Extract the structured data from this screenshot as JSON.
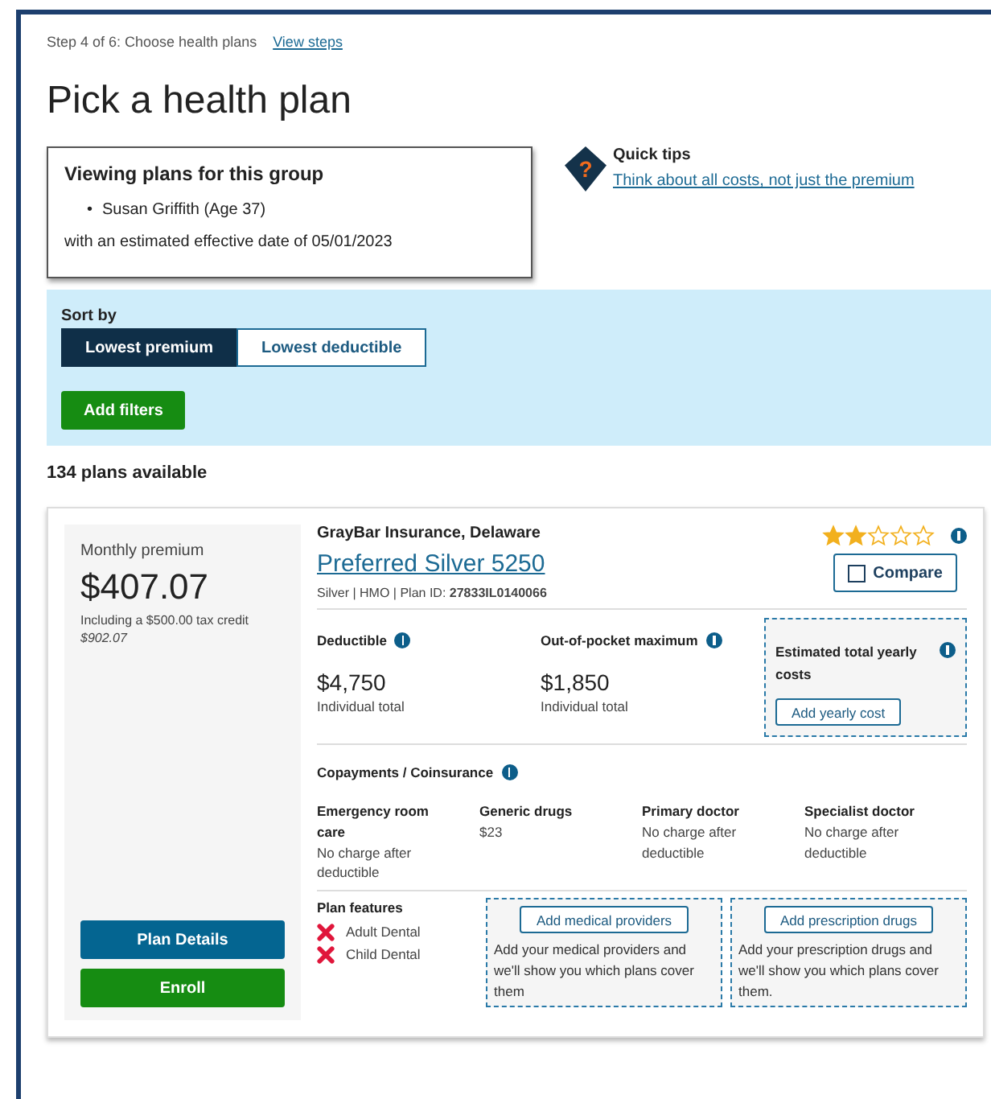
{
  "breadcrumb": {
    "step": "Step 4 of 6: Choose health plans",
    "link": "View steps"
  },
  "title": "Pick a health plan",
  "group": {
    "heading": "Viewing plans for this group",
    "bullet": "•",
    "members": [
      "Susan Griffith (Age 37)"
    ],
    "note": "with an estimated effective date of 05/01/2023"
  },
  "tips": {
    "icon": "?",
    "heading": "Quick tips",
    "link": "Think about all costs, not just the premium"
  },
  "sort": {
    "label": "Sort by",
    "options": [
      {
        "label": "Lowest premium",
        "selected": true
      },
      {
        "label": "Lowest deductible",
        "selected": false
      }
    ],
    "filter_button": "Add filters"
  },
  "count": "134 plans available",
  "plan": {
    "premium_label": "Monthly premium",
    "premium": "$407.07",
    "credit": "Including a $500.00 tax credit",
    "full_price": "$902.07",
    "insurer": "GrayBar Insurance, Delaware",
    "name": "Preferred Silver 5250",
    "meta": "Silver | HMO | Plan ID: ",
    "plan_id": "27833IL0140066",
    "stars": 2,
    "compare": {
      "label": "Compare",
      "checked": false
    },
    "costs": [
      {
        "label": "Deductible",
        "value": "$4,750",
        "note": "Individual total"
      },
      {
        "label": "Out-of-pocket maximum",
        "value": "$1,850",
        "note": "Individual total"
      }
    ],
    "yearly": {
      "label": "Estimated total yearly costs",
      "button": "Add yearly cost"
    },
    "copay_heading": "Copayments / Coinsurance",
    "copays": [
      {
        "label": "Emergency room care",
        "value": "No charge after deductible"
      },
      {
        "label": "Generic drugs",
        "value": "$23"
      },
      {
        "label": "Primary doctor",
        "value": "No charge after deductible"
      },
      {
        "label": "Specialist doctor",
        "value": "No charge after deductible"
      }
    ],
    "features_heading": "Plan features",
    "features": [
      {
        "label": "Adult Dental",
        "included": false
      },
      {
        "label": "Child Dental",
        "included": false
      }
    ],
    "adders": [
      {
        "button": "Add medical providers",
        "text": "Add your medical providers and we'll show you which plans cover them"
      },
      {
        "button": "Add prescription drugs",
        "text": "Add your prescription drugs and we'll show you which plans cover them."
      }
    ],
    "details_button": "Plan Details",
    "enroll_button": "Enroll"
  }
}
